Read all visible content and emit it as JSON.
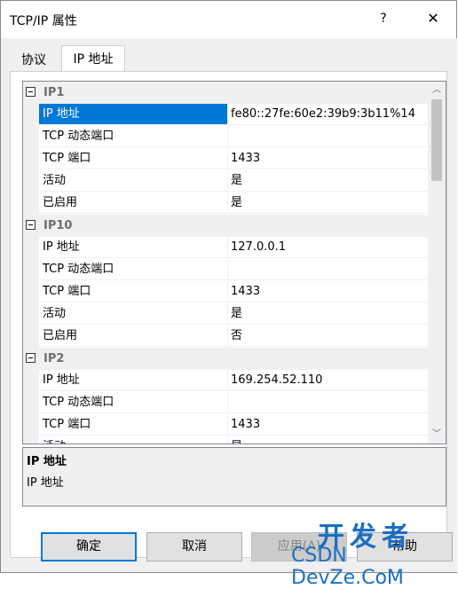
{
  "window": {
    "title": "TCP/IP 属性",
    "help_glyph": "?",
    "close_glyph": "✕"
  },
  "tabs": [
    {
      "label": "协议",
      "selected": false
    },
    {
      "label": "IP 地址",
      "selected": true
    }
  ],
  "grid": {
    "categories": [
      {
        "name": "IP1",
        "rows": [
          {
            "name": "IP 地址",
            "value": "fe80::27fe:60e2:39b9:3b11%14"
          },
          {
            "name": "TCP 动态端口",
            "value": ""
          },
          {
            "name": "TCP 端口",
            "value": "1433"
          },
          {
            "name": "活动",
            "value": "是"
          },
          {
            "name": "已启用",
            "value": "是"
          }
        ]
      },
      {
        "name": "IP10",
        "rows": [
          {
            "name": "IP 地址",
            "value": "127.0.0.1"
          },
          {
            "name": "TCP 动态端口",
            "value": ""
          },
          {
            "name": "TCP 端口",
            "value": "1433"
          },
          {
            "name": "活动",
            "value": "是"
          },
          {
            "name": "已启用",
            "value": "否"
          }
        ]
      },
      {
        "name": "IP2",
        "rows": [
          {
            "name": "IP 地址",
            "value": "169.254.52.110"
          },
          {
            "name": "TCP 动态端口",
            "value": ""
          },
          {
            "name": "TCP 端口",
            "value": "1433"
          },
          {
            "name": "活动",
            "value": "是"
          }
        ]
      }
    ],
    "scroll_up_glyph": "︿",
    "scroll_down_glyph": "﹀"
  },
  "description": {
    "title": "IP 地址",
    "text": "IP 地址"
  },
  "buttons": {
    "ok": "确定",
    "cancel": "取消",
    "apply": "应用(A)",
    "help": "帮助"
  },
  "watermark": {
    "big": "开发者",
    "small": "CSDN DevZe.CoM"
  },
  "colors": {
    "selection": "#0078d7",
    "category_bg": "#f0f0f0"
  }
}
